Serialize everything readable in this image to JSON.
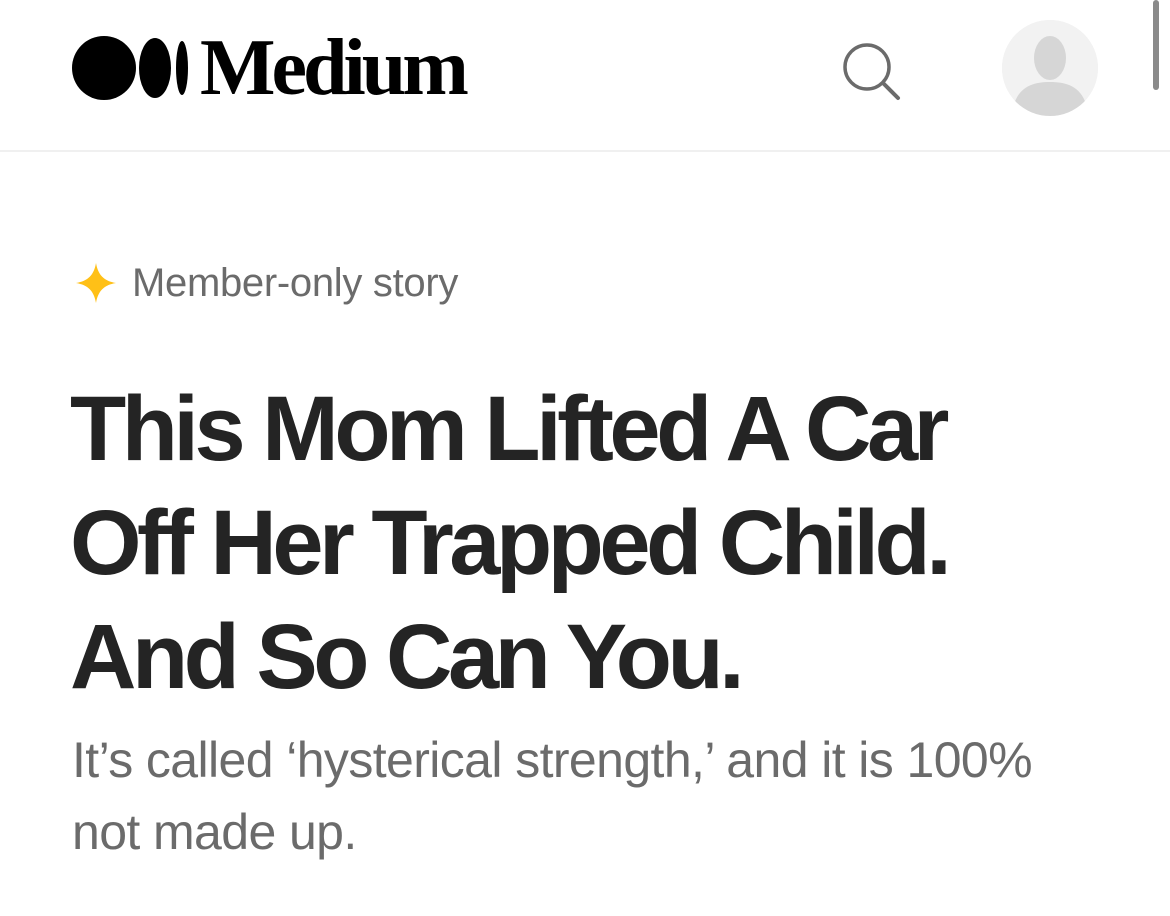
{
  "header": {
    "logo_text": "Medium",
    "logo_icon": "medium-logo-mark",
    "search_icon": "search-icon",
    "avatar_icon": "default-avatar-icon"
  },
  "article": {
    "badge_icon": "member-star-icon",
    "badge_color": "#FFC017",
    "badge_label": "Member-only story",
    "title": "This Mom Lifted A Car Off Her Trapped Child. And So Can You.",
    "subtitle": "It’s called ‘hysterical strength,’ and it is 100% not made up."
  },
  "colors": {
    "title": "#242424",
    "secondary_text": "#6B6B6B",
    "divider": "#F0F0F0"
  }
}
